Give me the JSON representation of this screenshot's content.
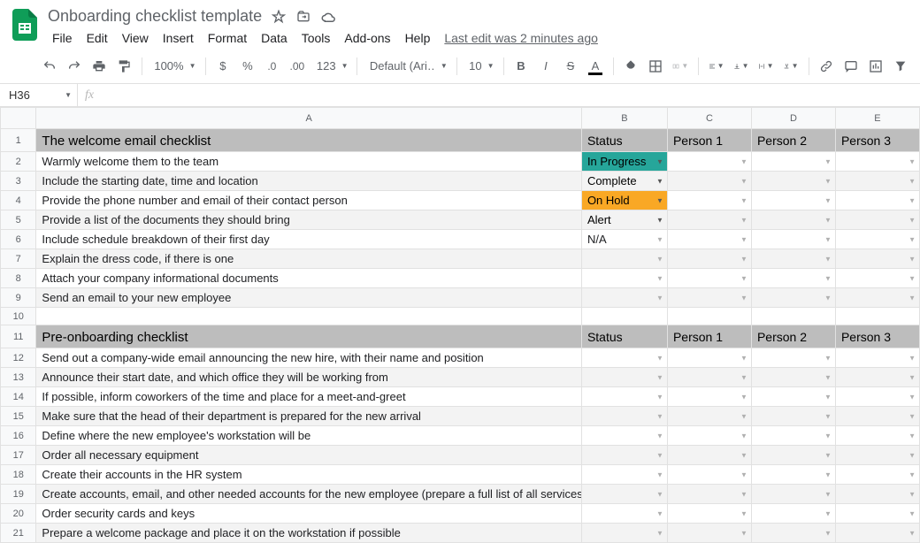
{
  "header": {
    "doc_name": "Onboarding checklist template",
    "menus": [
      "File",
      "Edit",
      "View",
      "Insert",
      "Format",
      "Data",
      "Tools",
      "Add-ons",
      "Help"
    ],
    "last_edit": "Last edit was 2 minutes ago"
  },
  "toolbar": {
    "zoom": "100%",
    "font": "Default (Ari…",
    "font_size": "10",
    "more_formats": "123"
  },
  "formula": {
    "namebox": "H36",
    "fx": "fx"
  },
  "columns": [
    "A",
    "B",
    "C",
    "D",
    "E"
  ],
  "sheet": {
    "section1_title": "The welcome email checklist",
    "section2_title": "Pre-onboarding checklist",
    "status_label": "Status",
    "person1": "Person 1",
    "person2": "Person 2",
    "person3": "Person 3"
  },
  "rows": [
    {
      "n": 1,
      "type": "header",
      "cells": [
        "The welcome email checklist",
        "Status",
        "Person 1",
        "Person 2",
        "Person 3"
      ]
    },
    {
      "n": 2,
      "type": "data",
      "banded": false,
      "cells": [
        "Warmly welcome them to the team",
        "In Progress",
        "",
        "",
        ""
      ],
      "status": "inprogress"
    },
    {
      "n": 3,
      "type": "data",
      "banded": true,
      "cells": [
        "Include the starting date, time and location",
        "Complete",
        "",
        "",
        ""
      ],
      "status": "complete"
    },
    {
      "n": 4,
      "type": "data",
      "banded": false,
      "cells": [
        "Provide the phone number and email of their contact person",
        "On Hold",
        "",
        "",
        ""
      ],
      "status": "hold"
    },
    {
      "n": 5,
      "type": "data",
      "banded": true,
      "cells": [
        "Provide a list of the documents they should bring",
        "Alert",
        "",
        "",
        ""
      ],
      "status": "alert"
    },
    {
      "n": 6,
      "type": "data",
      "banded": false,
      "cells": [
        "Include schedule breakdown of their first day",
        "N/A",
        "",
        "",
        ""
      ],
      "status": ""
    },
    {
      "n": 7,
      "type": "data",
      "banded": true,
      "cells": [
        "Explain the dress code, if there is one",
        "",
        "",
        "",
        ""
      ],
      "status": ""
    },
    {
      "n": 8,
      "type": "data",
      "banded": false,
      "cells": [
        "Attach your company informational documents",
        "",
        "",
        "",
        ""
      ],
      "status": ""
    },
    {
      "n": 9,
      "type": "data",
      "banded": true,
      "cells": [
        "Send an email to your new employee",
        "",
        "",
        "",
        ""
      ],
      "status": ""
    },
    {
      "n": 10,
      "type": "blank",
      "cells": [
        "",
        "",
        "",
        "",
        ""
      ]
    },
    {
      "n": 11,
      "type": "header",
      "cells": [
        "Pre-onboarding checklist",
        "Status",
        "Person 1",
        "Person 2",
        "Person 3"
      ]
    },
    {
      "n": 12,
      "type": "data",
      "banded": false,
      "cells": [
        "Send out a company-wide email announcing the new hire, with their name and position",
        "",
        "",
        "",
        ""
      ],
      "status": ""
    },
    {
      "n": 13,
      "type": "data",
      "banded": true,
      "cells": [
        "Announce their start date, and which office they will be working from",
        "",
        "",
        "",
        ""
      ],
      "status": ""
    },
    {
      "n": 14,
      "type": "data",
      "banded": false,
      "cells": [
        "If possible, inform coworkers of the time and place for a meet-and-greet",
        "",
        "",
        "",
        ""
      ],
      "status": ""
    },
    {
      "n": 15,
      "type": "data",
      "banded": true,
      "cells": [
        "Make sure that the head of their department is prepared for the new arrival",
        "",
        "",
        "",
        ""
      ],
      "status": ""
    },
    {
      "n": 16,
      "type": "data",
      "banded": false,
      "cells": [
        "Define where the new employee's workstation will be",
        "",
        "",
        "",
        ""
      ],
      "status": ""
    },
    {
      "n": 17,
      "type": "data",
      "banded": true,
      "cells": [
        "Order all necessary equipment",
        "",
        "",
        "",
        ""
      ],
      "status": ""
    },
    {
      "n": 18,
      "type": "data",
      "banded": false,
      "cells": [
        "Create their accounts in the HR system",
        "",
        "",
        "",
        ""
      ],
      "status": ""
    },
    {
      "n": 19,
      "type": "data",
      "banded": true,
      "cells": [
        "Create accounts, email, and other needed accounts for the new employee (prepare a full list of all services)",
        "",
        "",
        "",
        ""
      ],
      "status": ""
    },
    {
      "n": 20,
      "type": "data",
      "banded": false,
      "cells": [
        "Order security cards and keys",
        "",
        "",
        "",
        ""
      ],
      "status": ""
    },
    {
      "n": 21,
      "type": "data",
      "banded": true,
      "cells": [
        "Prepare a welcome package and place it on the workstation if possible",
        "",
        "",
        "",
        ""
      ],
      "status": ""
    }
  ]
}
